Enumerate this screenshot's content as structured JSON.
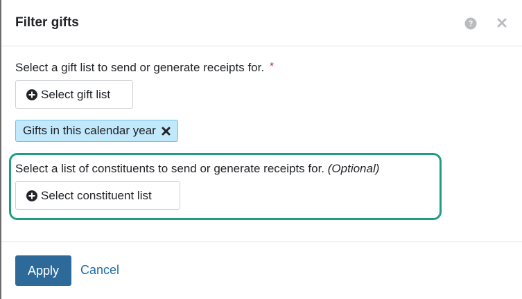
{
  "dialog": {
    "title": "Filter gifts",
    "help_icon": "question-circle-icon",
    "close_icon": "close-icon"
  },
  "gift_list": {
    "label": "Select a gift list to send or generate receipts for.",
    "required_marker": "*",
    "button_label": "Select gift list",
    "selected_token": "Gifts in this calendar year",
    "remove_icon": "close-x-icon"
  },
  "constituent_list": {
    "label": "Select a list of constituents to send or generate receipts for.",
    "optional_text": "(Optional)",
    "button_label": "Select constituent list"
  },
  "footer": {
    "apply_label": "Apply",
    "cancel_label": "Cancel"
  },
  "colors": {
    "primary": "#2d6a9a",
    "link": "#1e6ca8",
    "token_bg": "#c1e8fb",
    "token_border": "#71bfe6",
    "highlight": "#1f9e85",
    "required": "#c4262e"
  }
}
